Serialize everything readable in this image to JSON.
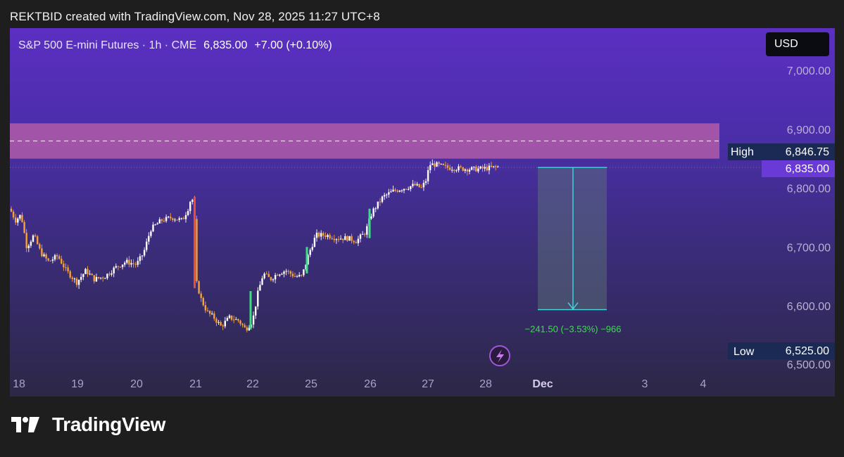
{
  "caption": "REKTBID created with TradingView.com, Nov 28, 2025 11:27 UTC+8",
  "header": {
    "symbol": "S&P 500 E-mini Futures · 1h · CME",
    "price": "6,835.00",
    "change": "+7.00 (+0.10%)",
    "currency": "USD"
  },
  "brand": "TradingView",
  "colors": {
    "accent_zone": "#b05aa8",
    "measure_line": "#3fd9e0",
    "measure_text": "#3ddc4e",
    "candle_up": "#ffffff",
    "candle_down": "#f6a23a"
  },
  "chart_data": {
    "type": "candlestick",
    "title": "S&P 500 E-mini Futures · 1h · CME",
    "ylim": [
      6500,
      7050
    ],
    "y_ticks": [
      "7,000.00",
      "6,900.00",
      "6,800.00",
      "6,700.00",
      "6,600.00",
      "6,500.00"
    ],
    "x_ticks": [
      "18",
      "19",
      "20",
      "21",
      "22",
      "25",
      "26",
      "27",
      "28",
      "Dec",
      "3",
      "4"
    ],
    "resistance_zone": [
      6850,
      6910
    ],
    "dashed_level": 6880,
    "last_price": 6835.0,
    "high_label": "High",
    "high_value": "6,846.75",
    "last_value": "6,835.00",
    "low_label": "Low",
    "low_value": "6,525.00",
    "measure": {
      "from": 6835.0,
      "to": 6593.5,
      "text": "−241.50 (−3.53%) −966"
    },
    "series": [
      {
        "x": "18",
        "close": 6760
      },
      {
        "x": "19",
        "close": 6650
      },
      {
        "x": "20",
        "close": 6750
      },
      {
        "x": "21",
        "close": 6780
      },
      {
        "x": "21",
        "close": 6580
      },
      {
        "x": "22",
        "close": 6560
      },
      {
        "x": "25",
        "close": 6720
      },
      {
        "x": "26",
        "close": 6760
      },
      {
        "x": "27",
        "close": 6840
      },
      {
        "x": "28",
        "close": 6835
      }
    ]
  }
}
